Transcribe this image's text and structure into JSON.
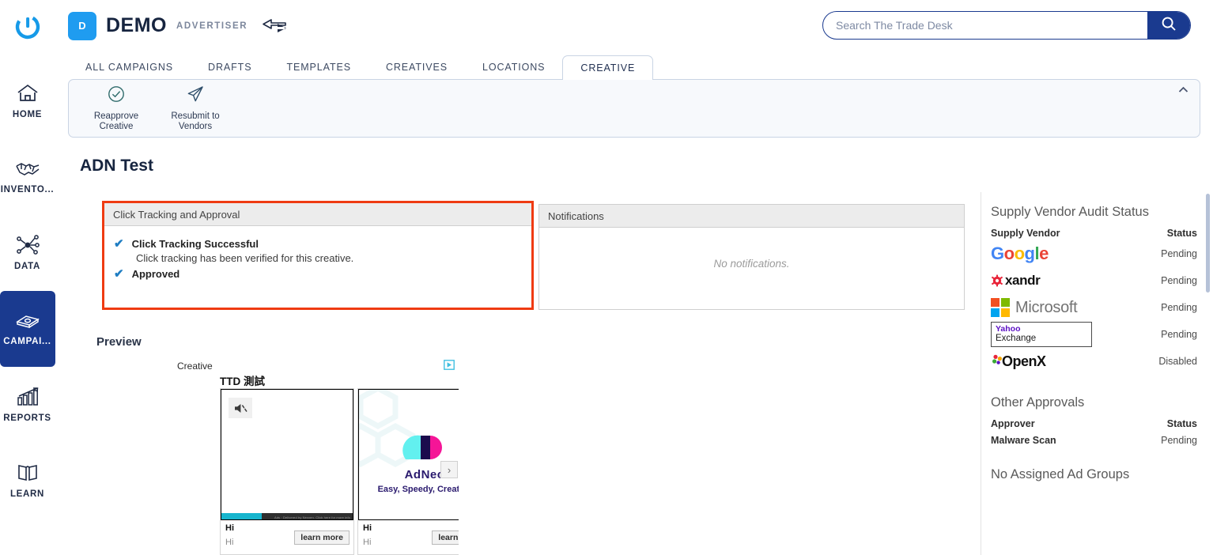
{
  "header": {
    "logo_icon": "trade-desk-logo",
    "badge_letter": "D",
    "brand_name": "DEMO",
    "brand_sub": "ADVERTISER",
    "switch_icon": "switch-advertiser-arrow-icon",
    "accent_blue": "#1f9cf0",
    "navy": "#1a3a8f"
  },
  "search": {
    "placeholder": "Search The Trade Desk",
    "value": "",
    "icon": "search-icon"
  },
  "sidebar": {
    "items": [
      {
        "label": "HOME",
        "icon": "home-icon",
        "active": false
      },
      {
        "label": "INVENTO...",
        "icon": "handshake-icon",
        "active": false
      },
      {
        "label": "DATA",
        "icon": "network-nodes-icon",
        "active": false
      },
      {
        "label": "CAMPAI...",
        "icon": "money-stack-icon",
        "active": true
      },
      {
        "label": "REPORTS",
        "icon": "bar-chart-arrow-icon",
        "active": false
      },
      {
        "label": "LEARN",
        "icon": "open-book-icon",
        "active": false
      }
    ]
  },
  "tabs": [
    {
      "label": "ALL CAMPAIGNS",
      "active": false
    },
    {
      "label": "DRAFTS",
      "active": false
    },
    {
      "label": "TEMPLATES",
      "active": false
    },
    {
      "label": "CREATIVES",
      "active": false
    },
    {
      "label": "LOCATIONS",
      "active": false
    },
    {
      "label": "CREATIVE",
      "active": true
    }
  ],
  "toolbar": {
    "actions": [
      {
        "label": "Reapprove Creative",
        "icon": "check-circle-icon"
      },
      {
        "label": "Resubmit to Vendors",
        "icon": "paper-plane-icon"
      }
    ],
    "collapse_icon": "chevron-up-icon"
  },
  "page": {
    "title": "ADN Test"
  },
  "tracking_panel": {
    "title": "Click Tracking and Approval",
    "border_color": "#ef3b12",
    "items": [
      {
        "title": "Click Tracking Successful",
        "desc": "Click tracking has been verified for this creative.",
        "icon": "check-icon"
      },
      {
        "title": "Approved",
        "desc": "",
        "icon": "check-icon"
      }
    ]
  },
  "notifications_panel": {
    "title": "Notifications",
    "empty_text": "No notifications."
  },
  "preview": {
    "section_label": "Preview",
    "creative_label": "Creative",
    "adchoices_icon": "adchoices-icon",
    "creative_title": "TTD 測試",
    "next_icon": "chevron-right-icon",
    "cards": [
      {
        "type": "video",
        "mute_icon": "speaker-muted-icon",
        "progress_percent": 31,
        "progress_color": "#17b5ce",
        "meta": "Ads · Delivered by Nexxen. Click here for more info",
        "title": "Hi",
        "desc": "Hi",
        "cta": "learn more"
      },
      {
        "type": "display",
        "brand": "AdNeo",
        "tagline": "Easy, Speedy, Creative",
        "title": "Hi",
        "desc": "Hi",
        "cta": "learn more"
      }
    ]
  },
  "right_panel": {
    "vendor_heading": "Supply Vendor Audit Status",
    "vendor_col_name": "Supply Vendor",
    "vendor_col_status": "Status",
    "vendors": [
      {
        "name": "Google",
        "logo": "google-logo",
        "status": "Pending"
      },
      {
        "name": "xandr",
        "logo": "xandr-logo",
        "status": "Pending"
      },
      {
        "name": "Microsoft",
        "logo": "microsoft-logo",
        "status": "Pending"
      },
      {
        "name": "Yahoo Exchange",
        "logo": "yahoo-exchange-logo",
        "status": "Pending"
      },
      {
        "name": "OpenX",
        "logo": "openx-logo",
        "status": "Disabled"
      }
    ],
    "other_heading": "Other Approvals",
    "approver_col_name": "Approver",
    "approver_col_status": "Status",
    "approvers": [
      {
        "name": "Malware Scan",
        "status": "Pending"
      }
    ],
    "no_adgroups": "No Assigned Ad Groups",
    "yahoo": {
      "top": "Yahoo",
      "bottom": "Exchange"
    },
    "google_letters": [
      {
        "ch": "G",
        "color": "#4285F4"
      },
      {
        "ch": "o",
        "color": "#EA4335"
      },
      {
        "ch": "o",
        "color": "#FBBC05"
      },
      {
        "ch": "g",
        "color": "#4285F4"
      },
      {
        "ch": "l",
        "color": "#34A853"
      },
      {
        "ch": "e",
        "color": "#EA4335"
      }
    ]
  }
}
